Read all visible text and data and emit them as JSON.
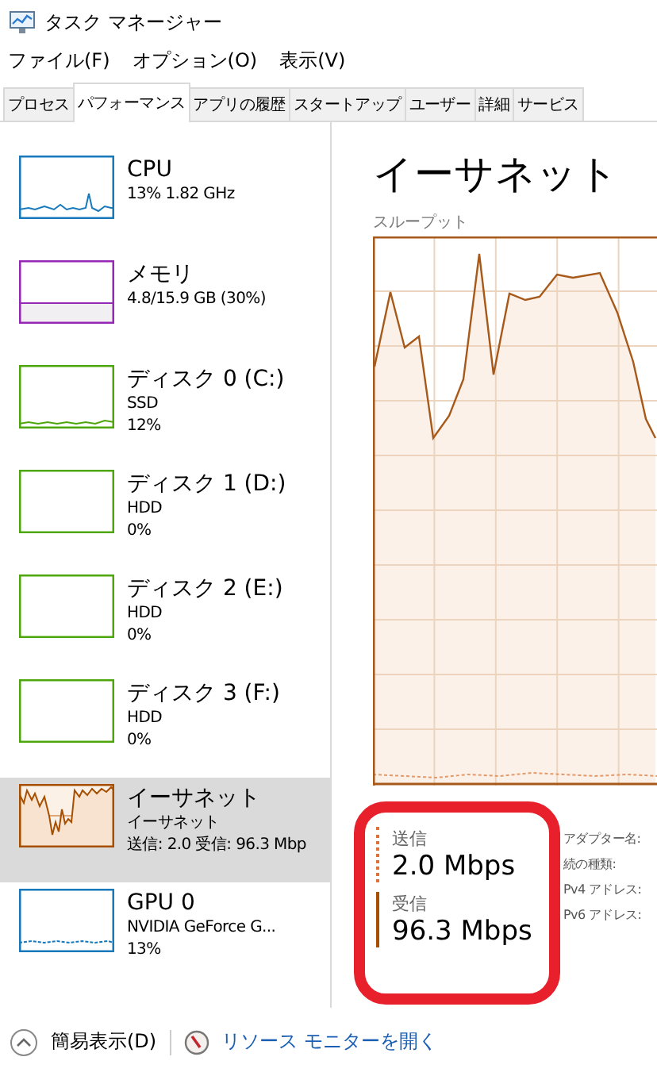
{
  "window": {
    "title": "タスク マネージャー"
  },
  "menu": [
    "ファイル(F)",
    "オプション(O)",
    "表示(V)"
  ],
  "tabs": [
    {
      "label": "プロセス",
      "selected": false
    },
    {
      "label": "パフォーマンス",
      "selected": true
    },
    {
      "label": "アプリの履歴",
      "selected": false
    },
    {
      "label": "スタートアップ",
      "selected": false
    },
    {
      "label": "ユーザー",
      "selected": false
    },
    {
      "label": "詳細",
      "selected": false
    },
    {
      "label": "サービス",
      "selected": false
    }
  ],
  "sidebar": {
    "items": [
      {
        "kind": "cpu",
        "name": "CPU",
        "lines": [
          "13%  1.82 GHz"
        ],
        "color": "#1779ba",
        "selected": false
      },
      {
        "kind": "memory",
        "name": "メモリ",
        "lines": [
          "4.8/15.9 GB (30%)"
        ],
        "color": "#9528b4",
        "selected": false
      },
      {
        "kind": "disk-active",
        "name": "ディスク 0 (C:)",
        "lines": [
          "SSD",
          "12%"
        ],
        "color": "#4da60c",
        "selected": false
      },
      {
        "kind": "disk",
        "name": "ディスク 1 (D:)",
        "lines": [
          "HDD",
          "0%"
        ],
        "color": "#4da60c",
        "selected": false
      },
      {
        "kind": "disk",
        "name": "ディスク 2 (E:)",
        "lines": [
          "HDD",
          "0%"
        ],
        "color": "#4da60c",
        "selected": false
      },
      {
        "kind": "disk",
        "name": "ディスク 3 (F:)",
        "lines": [
          "HDD",
          "0%"
        ],
        "color": "#4da60c",
        "selected": false
      },
      {
        "kind": "network",
        "name": "イーサネット",
        "lines": [
          "イーサネット",
          "送信: 2.0 受信: 96.3 Mbp"
        ],
        "color": "#a74f01",
        "selected": true
      },
      {
        "kind": "gpu",
        "name": "GPU 0",
        "lines": [
          "NVIDIA GeForce G...",
          "13%"
        ],
        "color": "#1779ba",
        "selected": false
      }
    ]
  },
  "detail": {
    "title": "イーサネット",
    "graph_label": "スループット",
    "stats": [
      {
        "kind": "send",
        "label": "送信",
        "value": "2.0 Mbps"
      },
      {
        "kind": "receive",
        "label": "受信",
        "value": "96.3 Mbps"
      }
    ],
    "properties": [
      "アダプター名:",
      "続の種類:",
      "Pv4 アドレス:",
      "Pv6 アドレス:"
    ]
  },
  "footer": {
    "fewer_details": "簡易表示(D)",
    "resource_monitor": "リソース モニターを開く"
  }
}
